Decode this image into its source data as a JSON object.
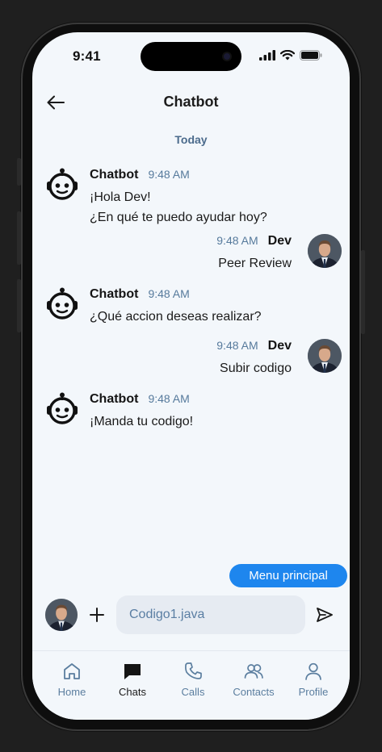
{
  "status_bar": {
    "time": "9:41"
  },
  "header": {
    "title": "Chatbot"
  },
  "conversation": {
    "date_separator": "Today",
    "messages": [
      {
        "sender": "Chatbot",
        "time": "9:48 AM",
        "lines": [
          "¡Hola Dev!",
          "¿En qué te puedo ayudar hoy?"
        ]
      },
      {
        "sender": "Dev",
        "time": "9:48 AM",
        "lines": [
          "Peer Review"
        ]
      },
      {
        "sender": "Chatbot",
        "time": "9:48 AM",
        "lines": [
          "¿Qué accion deseas realizar?"
        ]
      },
      {
        "sender": "Dev",
        "time": "9:48 AM",
        "lines": [
          "Subir codigo"
        ]
      },
      {
        "sender": "Chatbot",
        "time": "9:48 AM",
        "lines": [
          "¡Manda tu codigo!"
        ]
      }
    ]
  },
  "quick_reply": {
    "label": "Menu principal"
  },
  "composer": {
    "input_value": "Codigo1.java"
  },
  "tabbar": {
    "items": [
      {
        "label": "Home",
        "icon": "home-icon"
      },
      {
        "label": "Chats",
        "icon": "chat-icon",
        "active": true
      },
      {
        "label": "Calls",
        "icon": "phone-icon"
      },
      {
        "label": "Contacts",
        "icon": "contacts-icon"
      },
      {
        "label": "Profile",
        "icon": "profile-icon"
      }
    ]
  },
  "colors": {
    "accent": "#1e86ee",
    "background": "#f3f7fb",
    "muted": "#567a9c"
  }
}
